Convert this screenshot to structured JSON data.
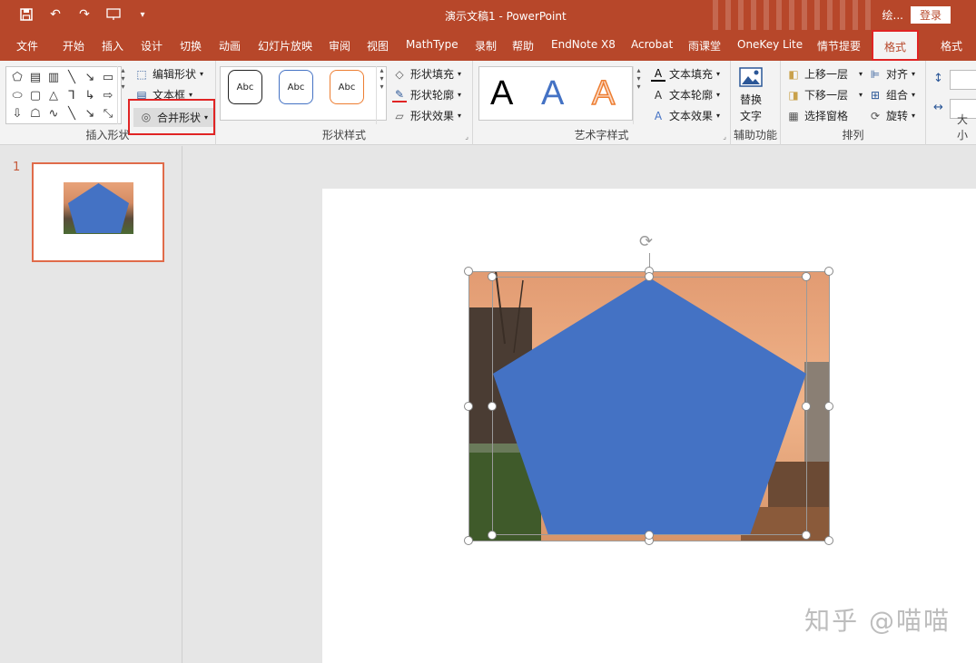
{
  "window": {
    "title": "演示文稿1  -  PowerPoint",
    "user_short": "绘...",
    "login_label": "登录"
  },
  "qat": {
    "icons": [
      "save-icon",
      "undo-icon",
      "redo-icon",
      "start-presentation-icon",
      "customize-qat-icon"
    ]
  },
  "tabs": [
    {
      "label": "文件"
    },
    {
      "label": "开始"
    },
    {
      "label": "插入"
    },
    {
      "label": "设计"
    },
    {
      "label": "切换"
    },
    {
      "label": "动画"
    },
    {
      "label": "幻灯片放映"
    },
    {
      "label": "审阅"
    },
    {
      "label": "视图"
    },
    {
      "label": "MathType"
    },
    {
      "label": "录制"
    },
    {
      "label": "帮助"
    },
    {
      "label": "EndNote X8"
    },
    {
      "label": "Acrobat"
    },
    {
      "label": "雨课堂"
    },
    {
      "label": "OneKey Lite"
    },
    {
      "label": "情节提要"
    },
    {
      "label": "格式"
    },
    {
      "label": "格式"
    }
  ],
  "ribbon": {
    "insert_shapes": {
      "label": "插入形状",
      "edit_shape": "编辑形状",
      "text_box": "文本框",
      "merge_shapes": "合并形状"
    },
    "shape_styles": {
      "label": "形状样式",
      "abc": [
        "Abc",
        "Abc",
        "Abc"
      ],
      "fill": "形状填充",
      "outline": "形状轮廓",
      "effects": "形状效果"
    },
    "wordart": {
      "label": "艺术字样式",
      "letters": [
        "A",
        "A",
        "A"
      ],
      "text_fill": "文本填充",
      "text_outline": "文本轮廓",
      "text_effects": "文本效果"
    },
    "accessibility": {
      "label": "辅助功能",
      "alt_text_line1": "替换",
      "alt_text_line2": "文字"
    },
    "arrange": {
      "label": "排列",
      "bring_forward": "上移一层",
      "send_backward": "下移一层",
      "selection_pane": "选择窗格",
      "align": "对齐",
      "group": "组合",
      "rotate": "旋转"
    },
    "size": {
      "label": "大小"
    }
  },
  "slides_panel": {
    "slide_number": "1"
  },
  "colors": {
    "accent": "#b7472a",
    "pentagon_fill": "#4472c4",
    "highlight_border": "#e02424"
  },
  "watermark": "知乎 @喵喵"
}
